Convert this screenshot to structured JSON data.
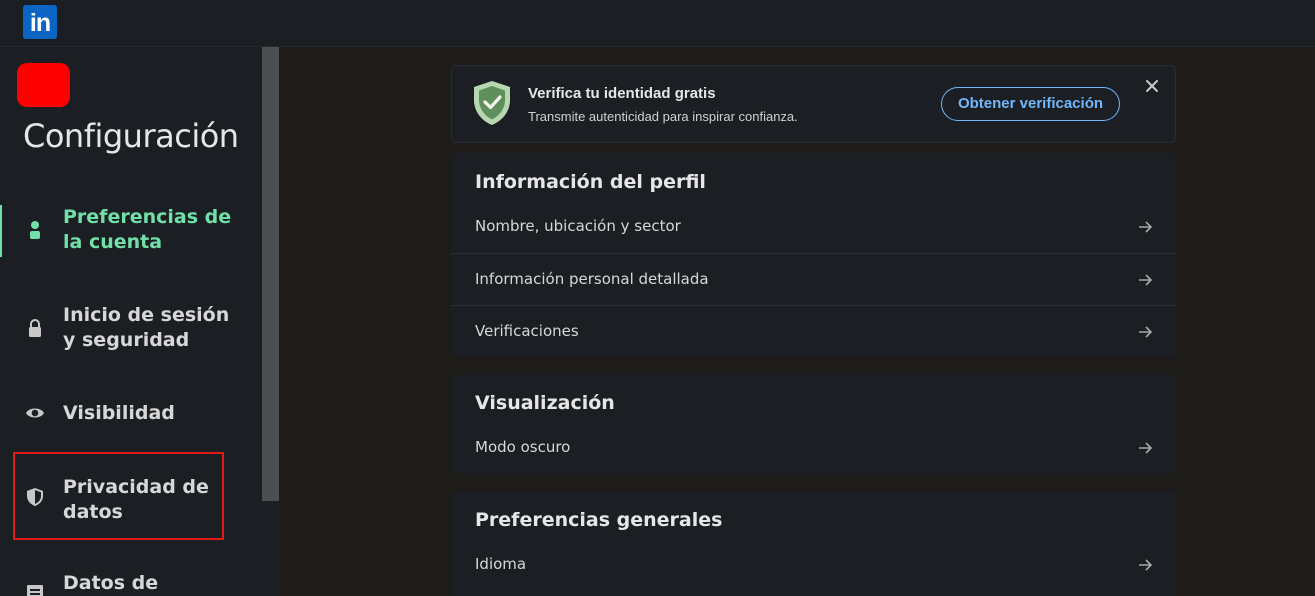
{
  "header": {
    "logo_text": "in"
  },
  "sidebar": {
    "title": "Configuración",
    "items": [
      {
        "label": "Preferencias de la cuenta",
        "icon": "person-icon",
        "active": true
      },
      {
        "label": "Inicio de sesión y seguridad",
        "icon": "lock-icon"
      },
      {
        "label": "Visibilidad",
        "icon": "eye-icon"
      },
      {
        "label": "Privacidad de datos",
        "icon": "shield-icon"
      },
      {
        "label": "Datos de",
        "icon": "document-icon"
      }
    ]
  },
  "verify_banner": {
    "title": "Verifica tu identidad gratis",
    "subtitle": "Transmite autenticidad para inspirar confianza.",
    "button": "Obtener verificación"
  },
  "sections": [
    {
      "title": "Información del perfil",
      "rows": [
        "Nombre, ubicación y sector",
        "Información personal detallada",
        "Verificaciones"
      ]
    },
    {
      "title": "Visualización",
      "rows": [
        "Modo oscuro"
      ]
    },
    {
      "title": "Preferencias generales",
      "rows": [
        "Idioma"
      ]
    }
  ],
  "colors": {
    "accent": "#71e0a8",
    "link": "#71b7fb",
    "highlight": "#e01818",
    "brand": "#0a66c2"
  }
}
